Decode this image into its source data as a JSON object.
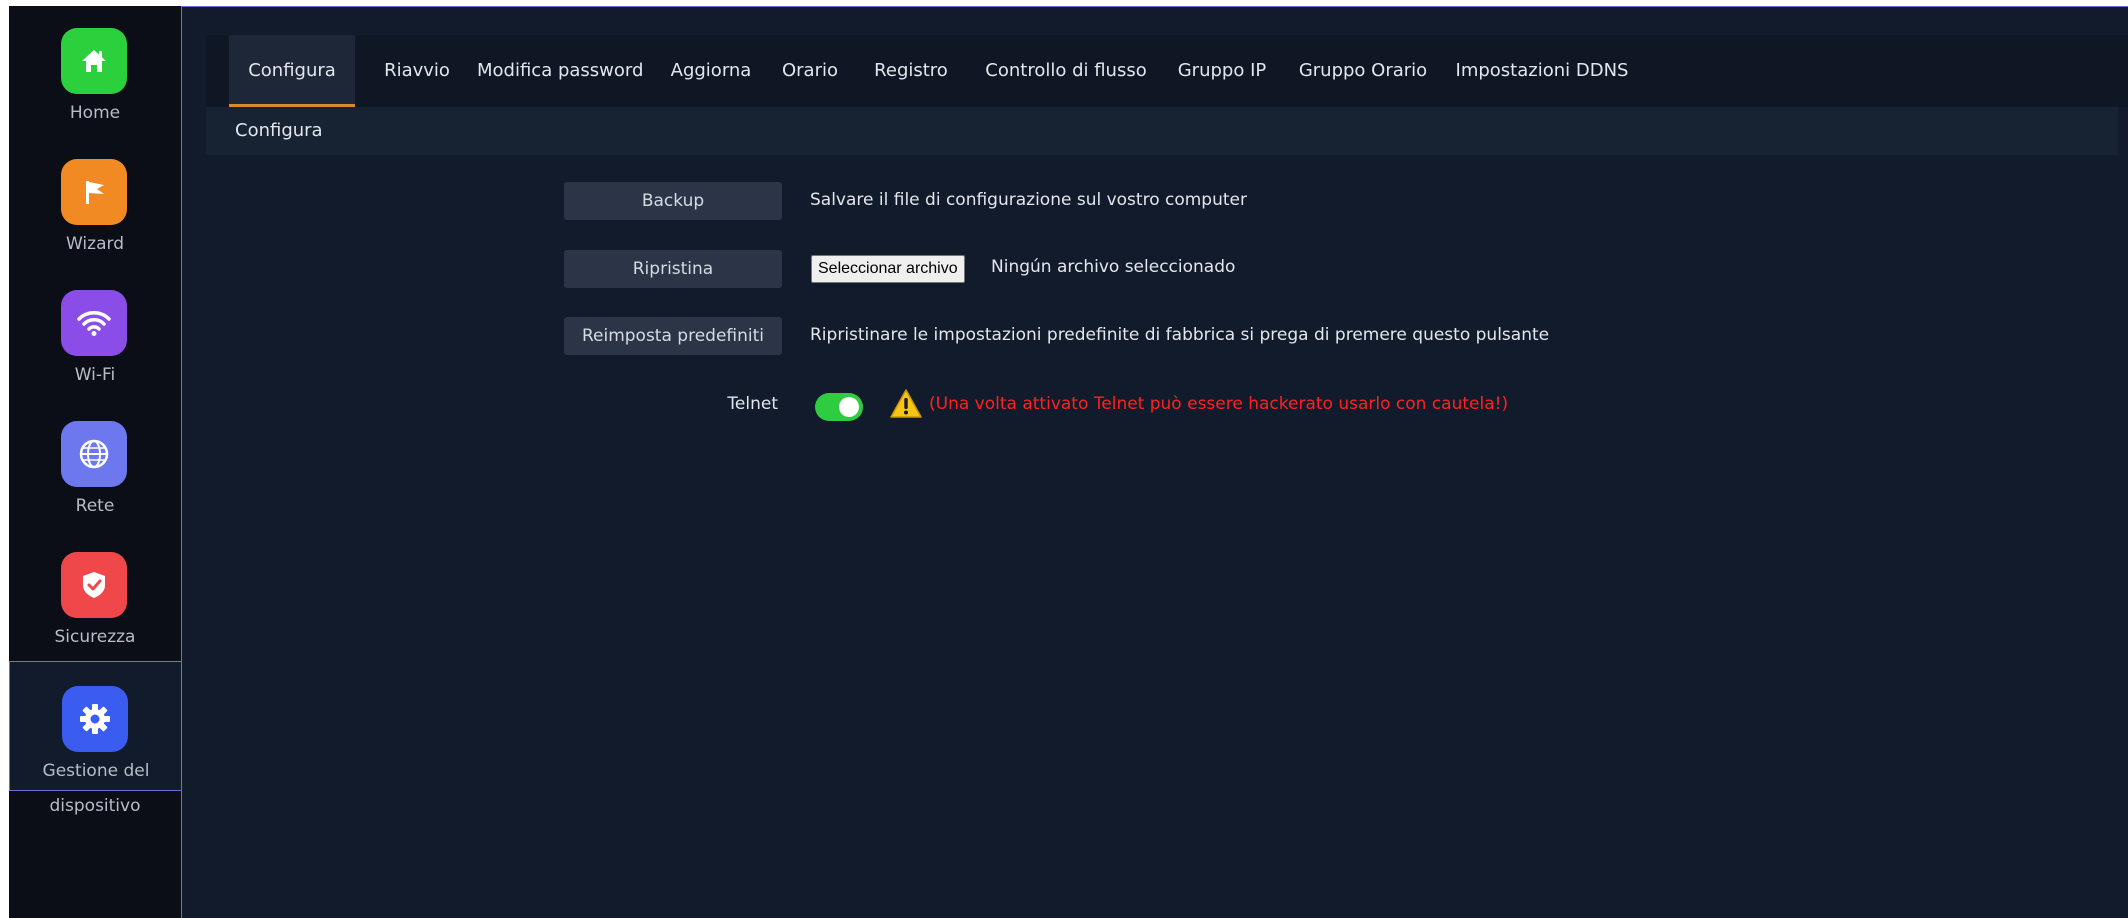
{
  "sidebar": {
    "items": [
      {
        "label": "Home",
        "icon": "home-icon",
        "color": "#2ccf3c"
      },
      {
        "label": "Wizard",
        "icon": "flag-icon",
        "color": "#f28a24"
      },
      {
        "label": "Wi-Fi",
        "icon": "wifi-icon",
        "color": "#8a4de8"
      },
      {
        "label": "Rete",
        "icon": "globe-icon",
        "color": "#6d78ee"
      },
      {
        "label": "Sicurezza",
        "icon": "shield-icon",
        "color": "#f0474a"
      },
      {
        "label_line1": "Gestione del",
        "label_line2": "dispositivo",
        "icon": "gear-icon",
        "color": "#3a5cf0",
        "active": true
      }
    ]
  },
  "tabs": [
    {
      "label": "Configura",
      "active": true
    },
    {
      "label": "Riavvio"
    },
    {
      "label": "Modifica password"
    },
    {
      "label": "Aggiorna"
    },
    {
      "label": "Orario"
    },
    {
      "label": "Registro"
    },
    {
      "label": "Controllo di flusso"
    },
    {
      "label": "Gruppo IP"
    },
    {
      "label": "Gruppo Orario"
    },
    {
      "label": "Impostazioni DDNS"
    }
  ],
  "breadcrumb": "Configura",
  "actions": {
    "backup": {
      "label": "Backup",
      "description": "Salvare il file di configurazione sul vostro computer"
    },
    "restore": {
      "label": "Ripristina",
      "file_button": "Seleccionar archivo",
      "file_status": "Ningún archivo seleccionado"
    },
    "reset": {
      "label": "Reimposta predefiniti",
      "description": "Ripristinare le impostazioni predefinite di fabbrica si prega di premere questo pulsante"
    }
  },
  "telnet": {
    "label": "Telnet",
    "enabled": true,
    "warning": "(Una volta attivato Telnet può essere hackerato usarlo con cautela!)",
    "toggle_color": "#2ecc40",
    "warning_color": "#ff2020"
  }
}
